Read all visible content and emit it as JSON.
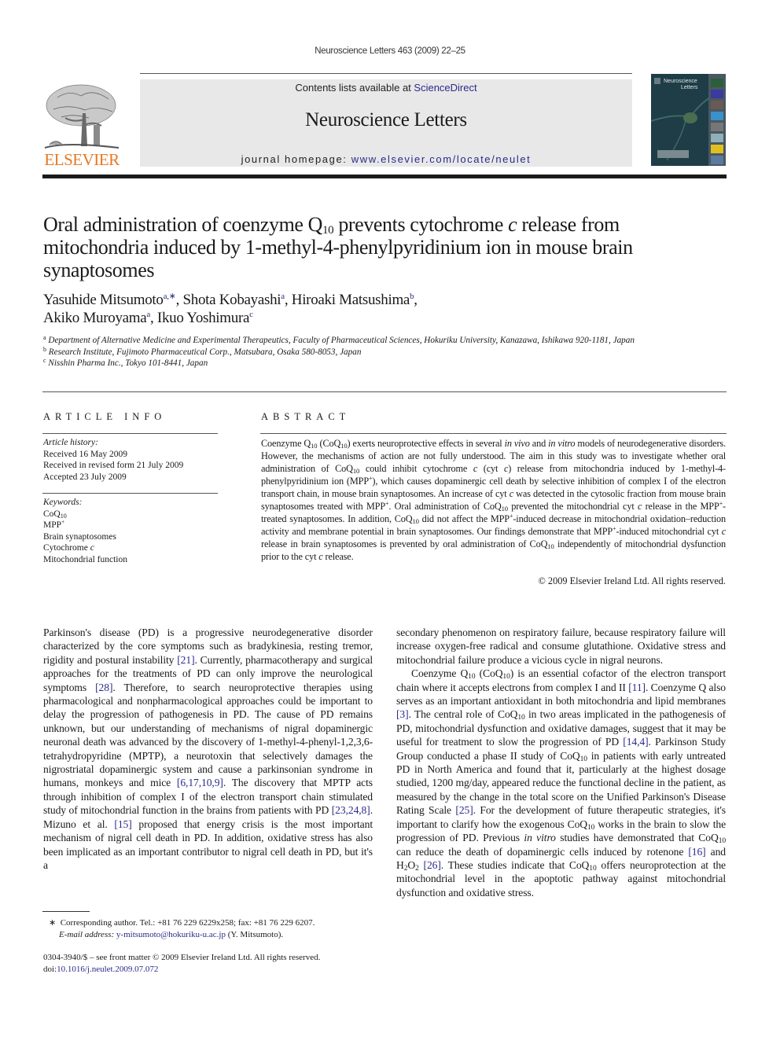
{
  "running_head": "Neuroscience Letters 463 (2009) 22–25",
  "banner": {
    "contents_prefix": "Contents lists available at ",
    "contents_link": "ScienceDirect",
    "journal_name": "Neuroscience Letters",
    "homepage_prefix": "journal homepage: ",
    "homepage_link": "www.elsevier.com/locate/neulet"
  },
  "publisher_logo": {
    "wordmark": "ELSEVIER",
    "color": "#e87722",
    "icon": "tree-logo-icon"
  },
  "cover": {
    "title_line1": "Neuroscience",
    "title_line2": "Letters",
    "icon": "journal-cover-icon"
  },
  "title": {
    "part1": "Oral administration of coenzyme Q",
    "sub": "10",
    "part2": " prevents cytochrome ",
    "italic": "c",
    "part3": " release from mitochondria induced by 1-methyl-4-phenylpyridinium ion in mouse brain synaptosomes"
  },
  "authors": [
    {
      "name": "Yasuhide Mitsumoto",
      "aff": "a,∗",
      "sep": ", "
    },
    {
      "name": "Shota Kobayashi",
      "aff": "a",
      "sep": ", "
    },
    {
      "name": "Hiroaki Matsushima",
      "aff": "b",
      "sep": ","
    },
    {
      "name": "Akiko Muroyama",
      "aff": "a",
      "sep": ", "
    },
    {
      "name": "Ikuo Yoshimura",
      "aff": "c",
      "sep": ""
    }
  ],
  "affiliations": [
    {
      "mark": "a",
      "text": "Department of Alternative Medicine and Experimental Therapeutics, Faculty of Pharmaceutical Sciences, Hokuriku University, Kanazawa, Ishikawa 920-1181, Japan"
    },
    {
      "mark": "b",
      "text": "Research Institute, Fujimoto Pharmaceutical Corp., Matsubara, Osaka 580-8053, Japan"
    },
    {
      "mark": "c",
      "text": "Nisshin Pharma Inc., Tokyo 101-8441, Japan"
    }
  ],
  "article_info": {
    "label": "ARTICLE INFO",
    "history_label": "Article history:",
    "history": [
      "Received 16 May 2009",
      "Received in revised form 21 July 2009",
      "Accepted 23 July 2009"
    ],
    "keywords_label": "Keywords:",
    "keywords": [
      "CoQ10",
      "MPP+",
      "Brain synaptosomes",
      "Cytochrome c",
      "Mitochondrial function"
    ]
  },
  "abstract": {
    "label": "ABSTRACT",
    "text": "Coenzyme Q10 (CoQ10) exerts neuroprotective effects in several in vivo and in vitro models of neurodegenerative disorders. However, the mechanisms of action are not fully understood. The aim in this study was to investigate whether oral administration of CoQ10 could inhibit cytochrome c (cyt c) release from mitochondria induced by 1-methyl-4-phenylpyridinium ion (MPP+), which causes dopaminergic cell death by selective inhibition of complex I of the electron transport chain, in mouse brain synaptosomes. An increase of cyt c was detected in the cytosolic fraction from mouse brain synaptosomes treated with MPP+. Oral administration of CoQ10 prevented the mitochondrial cyt c release in the MPP+-treated synaptosomes. In addition, CoQ10 did not affect the MPP+-induced decrease in mitochondrial oxidation–reduction activity and membrane potential in brain synaptosomes. Our findings demonstrate that MPP+-induced mitochondrial cyt c release in brain synaptosomes is prevented by oral administration of CoQ10 independently of mitochondrial dysfunction prior to the cyt c release.",
    "copyright": "© 2009 Elsevier Ireland Ltd. All rights reserved."
  },
  "body": {
    "left_column": "Parkinson's disease (PD) is a progressive neurodegenerative disorder characterized by the core symptoms such as bradykinesia, resting tremor, rigidity and postural instability [21]. Currently, pharmacotherapy and surgical approaches for the treatments of PD can only improve the neurological symptoms [28]. Therefore, to search neuroprotective therapies using pharmacological and nonpharmacological approaches could be important to delay the progression of pathogenesis in PD. The cause of PD remains unknown, but our understanding of mechanisms of nigral dopaminergic neuronal death was advanced by the discovery of 1-methyl-4-phenyl-1,2,3,6-tetrahydropyridine (MPTP), a neurotoxin that selectively damages the nigrostriatal dopaminergic system and cause a parkinsonian syndrome in humans, monkeys and mice [6,17,10,9]. The discovery that MPTP acts through inhibition of complex I of the electron transport chain stimulated study of mitochondrial function in the brains from patients with PD [23,24,8]. Mizuno et al. [15] proposed that energy crisis is the most important mechanism of nigral cell death in PD. In addition, oxidative stress has also been implicated as an important contributor to nigral cell death in PD, but it's a",
    "right_para1": "secondary phenomenon on respiratory failure, because respiratory failure will increase oxygen-free radical and consume glutathione. Oxidative stress and mitochondrial failure produce a vicious cycle in nigral neurons.",
    "right_para2": "Coenzyme Q10 (CoQ10) is an essential cofactor of the electron transport chain where it accepts electrons from complex I and II [11]. Coenzyme Q also serves as an important antioxidant in both mitochondria and lipid membranes [3]. The central role of CoQ10 in two areas implicated in the pathogenesis of PD, mitochondrial dysfunction and oxidative damages, suggest that it may be useful for treatment to slow the progression of PD [14,4]. Parkinson Study Group conducted a phase II study of CoQ10 in patients with early untreated PD in North America and found that it, particularly at the highest dosage studied, 1200 mg/day, appeared reduce the functional decline in the patient, as measured by the change in the total score on the Unified Parkinson's Disease Rating Scale [25]. For the development of future therapeutic strategies, it's important to clarify how the exogenous CoQ10 works in the brain to slow the progression of PD. Previous in vitro studies have demonstrated that CoQ10 can reduce the death of dopaminergic cells induced by rotenone [16] and H2O2 [26]. These studies indicate that CoQ10 offers neuroprotection at the mitochondrial level in the apoptotic pathway against mitochondrial dysfunction and oxidative stress.",
    "citations": [
      "[21]",
      "[28]",
      "[6,17,10,9]",
      "[23,24,8]",
      "[15]",
      "[11]",
      "[3]",
      "[14,4]",
      "[25]",
      "[16]",
      "[26]"
    ]
  },
  "footnote": {
    "mark": "∗",
    "corresponding": "Corresponding author. Tel.: +81 76 229 6229x258; fax: +81 76 229 6207.",
    "email_label": "E-mail address:",
    "email": "y-mitsumoto@hokuriku-u.ac.jp",
    "email_suffix": " (Y. Mitsumoto)."
  },
  "issn_line": "0304-3940/$ – see front matter © 2009 Elsevier Ireland Ltd. All rights reserved.",
  "doi_prefix": "doi:",
  "doi": "10.1016/j.neulet.2009.07.072",
  "colors": {
    "link": "#2a2a8a",
    "banner_bg": "#e8e8e8",
    "elsevier_orange": "#e87722"
  }
}
